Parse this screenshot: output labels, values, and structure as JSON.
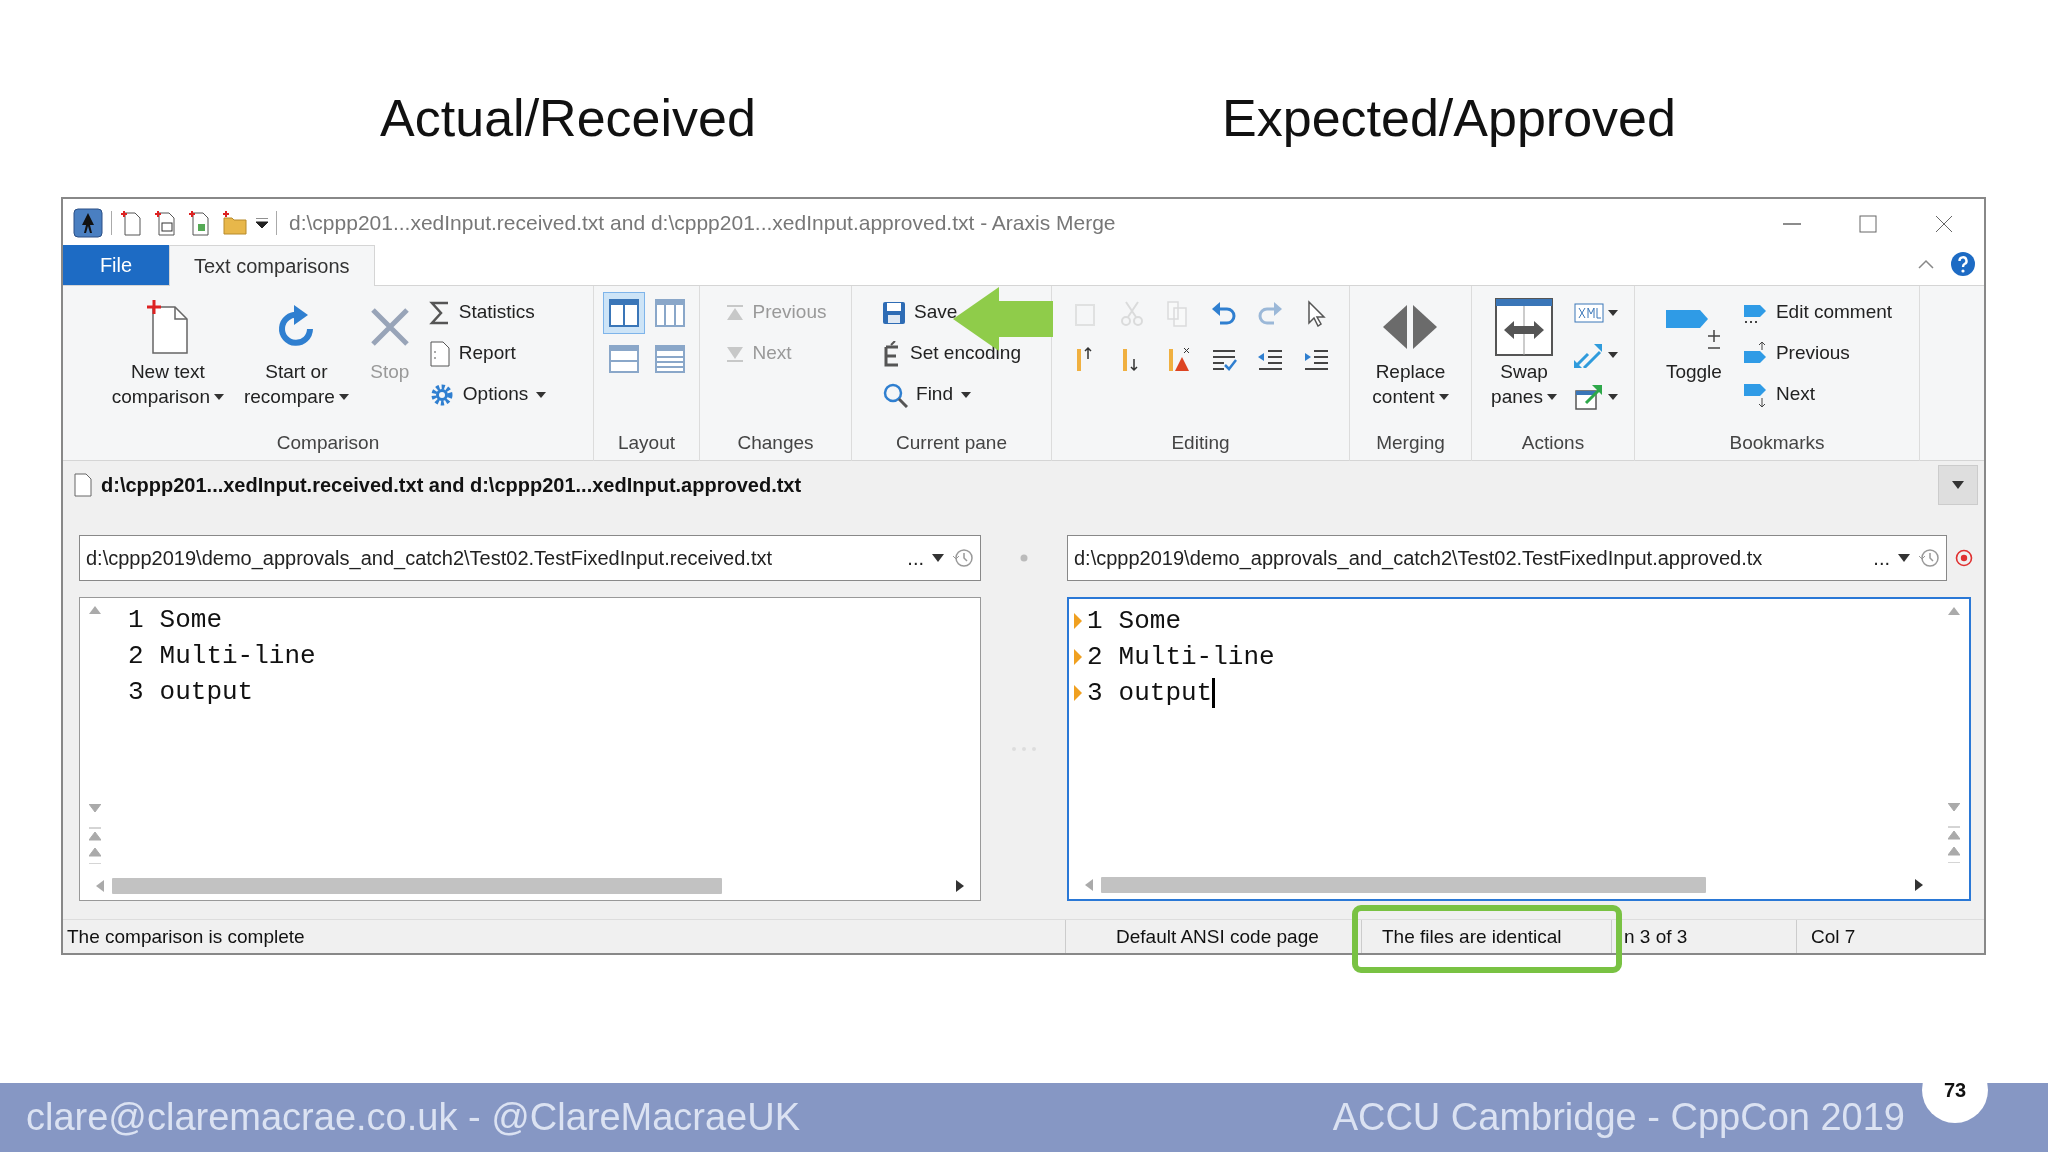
{
  "slide": {
    "headings": [
      "Actual/Received",
      "Expected/Approved"
    ],
    "footer_left": "clare@claremacrae.co.uk - @ClareMacraeUK",
    "footer_right": "ACCU Cambridge - CppCon 2019",
    "page_number": "73"
  },
  "window": {
    "title": "d:\\cppp201...xedInput.received.txt and d:\\cppp201...xedInput.approved.txt - Araxis Merge"
  },
  "tabs": [
    {
      "label": "File",
      "kind": "file",
      "selected": false
    },
    {
      "label": "Text comparisons",
      "kind": "tab",
      "selected": true
    }
  ],
  "ribbon": {
    "groups": [
      {
        "label": "Comparison",
        "items": [
          {
            "kind": "large",
            "lines": [
              "New text",
              "comparison"
            ],
            "dropdown": true,
            "disabled": false
          },
          {
            "kind": "large",
            "lines": [
              "Start or",
              "recompare"
            ],
            "dropdown": true,
            "disabled": false
          },
          {
            "kind": "large",
            "lines": [
              "Stop"
            ],
            "dropdown": false,
            "disabled": true
          },
          {
            "kind": "small",
            "label": "Statistics",
            "dropdown": false,
            "disabled": false
          },
          {
            "kind": "small",
            "label": "Report",
            "dropdown": false,
            "disabled": false
          },
          {
            "kind": "small",
            "label": "Options",
            "dropdown": true,
            "disabled": false
          }
        ]
      },
      {
        "label": "Layout",
        "items": [
          {
            "kind": "icon",
            "selected": true,
            "disabled": false
          },
          {
            "kind": "icon",
            "selected": false,
            "disabled": false
          },
          {
            "kind": "icon",
            "selected": false,
            "disabled": false
          },
          {
            "kind": "icon",
            "selected": false,
            "disabled": false
          }
        ]
      },
      {
        "label": "Changes",
        "items": [
          {
            "kind": "small",
            "label": "Previous",
            "dropdown": false,
            "disabled": true
          },
          {
            "kind": "small",
            "label": "Next",
            "dropdown": false,
            "disabled": true
          }
        ]
      },
      {
        "label": "Current pane",
        "items": [
          {
            "kind": "small",
            "label": "Save",
            "dropdown": false,
            "disabled": false
          },
          {
            "kind": "small",
            "label": "Set encoding",
            "dropdown": false,
            "disabled": false
          },
          {
            "kind": "small",
            "label": "Find",
            "dropdown": true,
            "disabled": false
          }
        ]
      },
      {
        "label": "Editing",
        "items": [
          {
            "kind": "icon",
            "disabled": true
          },
          {
            "kind": "icon",
            "disabled": true
          },
          {
            "kind": "icon",
            "disabled": true
          },
          {
            "kind": "icon",
            "disabled": false
          },
          {
            "kind": "icon",
            "disabled": false
          },
          {
            "kind": "icon",
            "disabled": false
          },
          {
            "kind": "icon",
            "disabled": false
          },
          {
            "kind": "icon",
            "disabled": false
          },
          {
            "kind": "icon",
            "disabled": false
          },
          {
            "kind": "icon",
            "disabled": false
          },
          {
            "kind": "icon",
            "disabled": false
          },
          {
            "kind": "icon",
            "disabled": false
          }
        ]
      },
      {
        "label": "Merging",
        "items": [
          {
            "kind": "large",
            "lines": [
              "Replace",
              "content"
            ],
            "dropdown": true,
            "disabled": false
          }
        ]
      },
      {
        "label": "Actions",
        "items": [
          {
            "kind": "large",
            "lines": [
              "Swap",
              "panes"
            ],
            "dropdown": true,
            "disabled": false
          },
          {
            "kind": "icon",
            "dropdown": true,
            "disabled": false
          },
          {
            "kind": "icon",
            "dropdown": true,
            "disabled": false
          },
          {
            "kind": "icon",
            "dropdown": true,
            "disabled": false
          }
        ]
      },
      {
        "label": "Bookmarks",
        "items": [
          {
            "kind": "large",
            "lines": [
              "Toggle"
            ],
            "dropdown": false,
            "disabled": false
          },
          {
            "kind": "small",
            "label": "Edit comment",
            "dropdown": false,
            "disabled": false
          },
          {
            "kind": "small",
            "label": "Previous",
            "dropdown": false,
            "disabled": false
          },
          {
            "kind": "small",
            "label": "Next",
            "dropdown": false,
            "disabled": false
          }
        ]
      }
    ]
  },
  "comparison_title": "d:\\cppp201...xedInput.received.txt and d:\\cppp201...xedInput.approved.txt",
  "panes": [
    {
      "path": "d:\\cppp2019\\demo_approvals_and_catch2\\Test02.TestFixedInput.received.txt",
      "path_more": "...",
      "focused": false,
      "lines": [
        {
          "number": "1",
          "text": "Some",
          "marker": false
        },
        {
          "number": "2",
          "text": "Multi-line",
          "marker": false
        },
        {
          "number": "3",
          "text": "output",
          "marker": false
        }
      ]
    },
    {
      "path": "d:\\cppp2019\\demo_approvals_and_catch2\\Test02.TestFixedInput.approved.tx",
      "path_more": "...",
      "focused": true,
      "lines": [
        {
          "number": "1",
          "text": "Some",
          "marker": true
        },
        {
          "number": "2",
          "text": "Multi-line",
          "marker": true
        },
        {
          "number": "3",
          "text": "output",
          "marker": true
        }
      ]
    }
  ],
  "status_bar": [
    "The comparison is complete",
    "Default ANSI code page",
    "The files are identical",
    "n 3 of 3",
    "Col 7"
  ]
}
